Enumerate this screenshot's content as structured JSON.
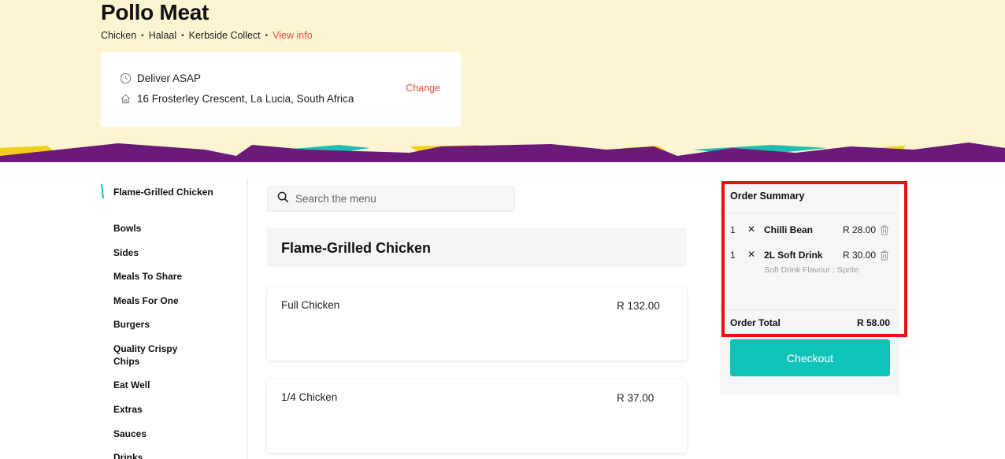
{
  "store": {
    "name": "Pollo Meat",
    "tags": [
      "Chicken",
      "Halaal",
      "Kerbside Collect"
    ],
    "view_info": "View info"
  },
  "delivery": {
    "time": "Deliver ASAP",
    "address": "16 Frosterley Crescent, La Lucia, South Africa",
    "change": "Change"
  },
  "sidebar": {
    "items": [
      {
        "label": "Flame-Grilled Chicken",
        "active": true
      },
      {
        "label": "Bowls"
      },
      {
        "label": "Sides"
      },
      {
        "label": "Meals To Share"
      },
      {
        "label": "Meals For One"
      },
      {
        "label": "Burgers"
      },
      {
        "label": "Quality Crispy Chips"
      },
      {
        "label": "Eat Well"
      },
      {
        "label": "Extras"
      },
      {
        "label": "Sauces"
      },
      {
        "label": "Drinks"
      }
    ]
  },
  "search": {
    "placeholder": "Search the menu"
  },
  "menu": {
    "section_title": "Flame-Grilled Chicken",
    "items": [
      {
        "name": "Full Chicken",
        "price": "R 132.00"
      },
      {
        "name": "1/4 Chicken",
        "price": "R 37.00"
      }
    ]
  },
  "order": {
    "title": "Order Summary",
    "lines": [
      {
        "qty": "1",
        "name": "Chilli Bean",
        "price": "R 28.00"
      },
      {
        "qty": "1",
        "name": "2L Soft Drink",
        "price": "R 30.00",
        "option": "Soft Drink Flavour : Sprite"
      }
    ],
    "total_label": "Order Total",
    "total_value": "R 58.00",
    "checkout": "Checkout"
  },
  "colors": {
    "hero_bg": "#fdf5d2",
    "accent_red": "#e84c3d",
    "teal": "#0fc4b7",
    "purple": "#6b1a7a",
    "yellow": "#f2cf1a",
    "highlight_border": "#ee0f0f"
  },
  "icons": {
    "delivery_time": "clock-icon",
    "delivery_address": "home-icon",
    "search": "search-icon",
    "remove_line": "trash-icon",
    "quantity_separator": "close-icon"
  }
}
